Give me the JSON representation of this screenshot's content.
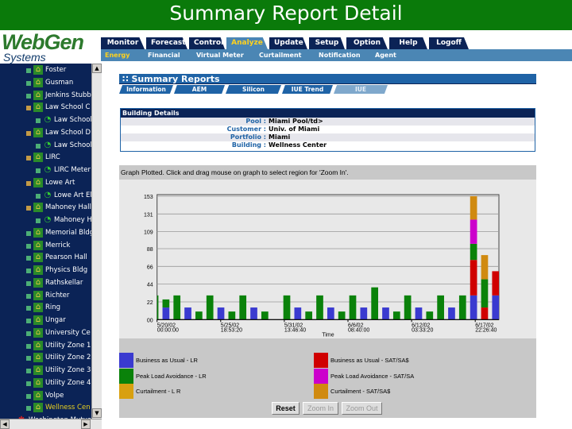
{
  "window_title": "Summary Report Detail",
  "logo": {
    "line1": "WebGen",
    "line2": "Systems"
  },
  "nav": {
    "tabs": [
      {
        "label": "Monitor",
        "active": false
      },
      {
        "label": "Forecast",
        "active": false
      },
      {
        "label": "Control",
        "active": false
      },
      {
        "label": "Analyze",
        "active": true
      },
      {
        "label": "Update",
        "active": false
      },
      {
        "label": "Setup",
        "active": false
      },
      {
        "label": "Option",
        "active": false
      },
      {
        "label": "Help",
        "active": false
      },
      {
        "label": "Logoff",
        "active": false
      }
    ],
    "subtabs": [
      {
        "label": "Energy",
        "active": true
      },
      {
        "label": "Financial"
      },
      {
        "label": "Virtual Meter"
      },
      {
        "label": "Curtailment"
      },
      {
        "label": "Notification"
      },
      {
        "label": "Agent"
      }
    ]
  },
  "tree": [
    {
      "label": "Foster",
      "type": "building",
      "state": "plus"
    },
    {
      "label": "Gusman",
      "type": "building",
      "state": "plus"
    },
    {
      "label": "Jenkins Stubb",
      "type": "building",
      "state": "plus"
    },
    {
      "label": "Law School C",
      "type": "building",
      "state": "minus"
    },
    {
      "label": "Law School",
      "type": "meter",
      "state": "plus"
    },
    {
      "label": "Law School D",
      "type": "building",
      "state": "minus"
    },
    {
      "label": "Law School",
      "type": "meter",
      "state": "plus"
    },
    {
      "label": "LIRC",
      "type": "building",
      "state": "minus"
    },
    {
      "label": "LIRC Meter",
      "type": "meter",
      "state": "plus"
    },
    {
      "label": "Lowe Art",
      "type": "building",
      "state": "minus"
    },
    {
      "label": "Lowe Art El",
      "type": "meter",
      "state": "plus"
    },
    {
      "label": "Mahoney Hall",
      "type": "building",
      "state": "minus"
    },
    {
      "label": "Mahoney H",
      "type": "meter",
      "state": "plus"
    },
    {
      "label": "Memorial Bldg",
      "type": "building",
      "state": "plus"
    },
    {
      "label": "Merrick",
      "type": "building",
      "state": "plus"
    },
    {
      "label": "Pearson Hall",
      "type": "building",
      "state": "plus"
    },
    {
      "label": "Physics Bldg",
      "type": "building",
      "state": "plus"
    },
    {
      "label": "Rathskellar",
      "type": "building",
      "state": "plus"
    },
    {
      "label": "Richter",
      "type": "building",
      "state": "plus"
    },
    {
      "label": "Ring",
      "type": "building",
      "state": "plus"
    },
    {
      "label": "Ungar",
      "type": "building",
      "state": "plus"
    },
    {
      "label": "University Ce",
      "type": "building",
      "state": "plus"
    },
    {
      "label": "Utility Zone 1",
      "type": "building",
      "state": "plus"
    },
    {
      "label": "Utility Zone 2",
      "type": "building",
      "state": "plus"
    },
    {
      "label": "Utility Zone 3",
      "type": "building",
      "state": "plus"
    },
    {
      "label": "Utility Zone 4",
      "type": "building",
      "state": "plus"
    },
    {
      "label": "Volpe",
      "type": "building",
      "state": "plus"
    },
    {
      "label": "Wellness Cen",
      "type": "building",
      "state": "plus",
      "selected": true
    },
    {
      "label": "Washington Mutual",
      "type": "portfolio",
      "state": "plus"
    }
  ],
  "summary": {
    "title": "Summary Reports",
    "tabs": [
      {
        "label": "Information"
      },
      {
        "label": "AEM"
      },
      {
        "label": "Silicon Energy"
      },
      {
        "label": "IUE Trend"
      },
      {
        "label": "IUE Summary",
        "active": true
      }
    ]
  },
  "building_details": {
    "title": "Building Details",
    "rows": [
      {
        "key": "Pool :",
        "value": "Miami Pool/td>"
      },
      {
        "key": "Customer :",
        "value": "Univ. of Miami"
      },
      {
        "key": "Portfolio :",
        "value": "Miami"
      },
      {
        "key": "Building :",
        "value": "Wellness Center"
      }
    ]
  },
  "graph_message": "Graph Plotted. Click and drag mouse on graph to select region for 'Zoom In'.",
  "buttons": {
    "reset": "Reset",
    "zoom_in": "Zoom In",
    "zoom_out": "Zoom Out"
  },
  "colors": {
    "title_green": "#0a7a0a",
    "nav_navy": "#0b2356",
    "nav_blue": "#4b86b4",
    "active_yellow": "#ffd21e"
  },
  "chart_data": {
    "type": "bar",
    "stacked": true,
    "xlabel": "Time",
    "ylabel": "",
    "ylim": [
      0,
      160
    ],
    "yticks": [
      "00",
      "22",
      "44",
      "66",
      "88",
      "109",
      "131",
      "153"
    ],
    "ytick_values": [
      0,
      22,
      44,
      66,
      88,
      109,
      131,
      153
    ],
    "xticks": [
      [
        "5/20/02",
        "00:00:00"
      ],
      [
        "5/25/02",
        "18:53:20"
      ],
      [
        "5/31/02",
        "13:46:40"
      ],
      [
        "6/6/02",
        "08:40:00"
      ],
      [
        "6/12/02",
        "03:33:20"
      ],
      [
        "6/17/02",
        "22:26:40"
      ]
    ],
    "grid": true,
    "legend_placement": "bottom",
    "series": [
      {
        "name": "Business as Usual - LR",
        "color": "#3a3ad0",
        "values": [
          0,
          15,
          0,
          15,
          0,
          0,
          15,
          0,
          0,
          15,
          0,
          null,
          0,
          15,
          0,
          0,
          15,
          0,
          0,
          15,
          0,
          15,
          0,
          0,
          15,
          0,
          0,
          15,
          0,
          30,
          0,
          30
        ]
      },
      {
        "name": "Business as Usual - SAT/SA$",
        "color": "#d00000",
        "values": [
          0,
          0,
          0,
          0,
          0,
          0,
          0,
          0,
          0,
          0,
          0,
          null,
          0,
          0,
          0,
          0,
          0,
          0,
          0,
          0,
          0,
          0,
          0,
          0,
          0,
          0,
          0,
          0,
          0,
          44,
          15,
          30
        ]
      },
      {
        "name": "Peak Load Avoidance - LR",
        "color": "#0a820a",
        "values": [
          30,
          10,
          30,
          0,
          10,
          30,
          0,
          10,
          30,
          0,
          10,
          null,
          30,
          0,
          10,
          30,
          0,
          10,
          30,
          0,
          40,
          0,
          10,
          30,
          0,
          10,
          30,
          0,
          30,
          20,
          35,
          0
        ]
      },
      {
        "name": "Peak Load Avoidance - SAT/SA",
        "color": "#cc00cc",
        "values": [
          0,
          0,
          0,
          0,
          0,
          0,
          0,
          0,
          0,
          0,
          0,
          null,
          0,
          0,
          0,
          0,
          0,
          0,
          0,
          0,
          0,
          0,
          0,
          0,
          0,
          0,
          0,
          0,
          0,
          30,
          0,
          0
        ]
      },
      {
        "name": "Curtailment - L R",
        "color": "#d8a010",
        "values": [
          0,
          0,
          0,
          0,
          0,
          0,
          0,
          0,
          0,
          0,
          0,
          null,
          0,
          0,
          0,
          0,
          0,
          0,
          0,
          0,
          0,
          0,
          0,
          0,
          0,
          0,
          0,
          0,
          0,
          0,
          0,
          0
        ]
      },
      {
        "name": "Curtailment - SAT/SA$",
        "color": "#d08a10",
        "values": [
          0,
          0,
          0,
          0,
          0,
          0,
          0,
          0,
          0,
          0,
          0,
          null,
          0,
          0,
          0,
          0,
          0,
          0,
          0,
          0,
          0,
          0,
          0,
          0,
          0,
          0,
          0,
          0,
          0,
          29,
          30,
          0
        ]
      }
    ]
  }
}
